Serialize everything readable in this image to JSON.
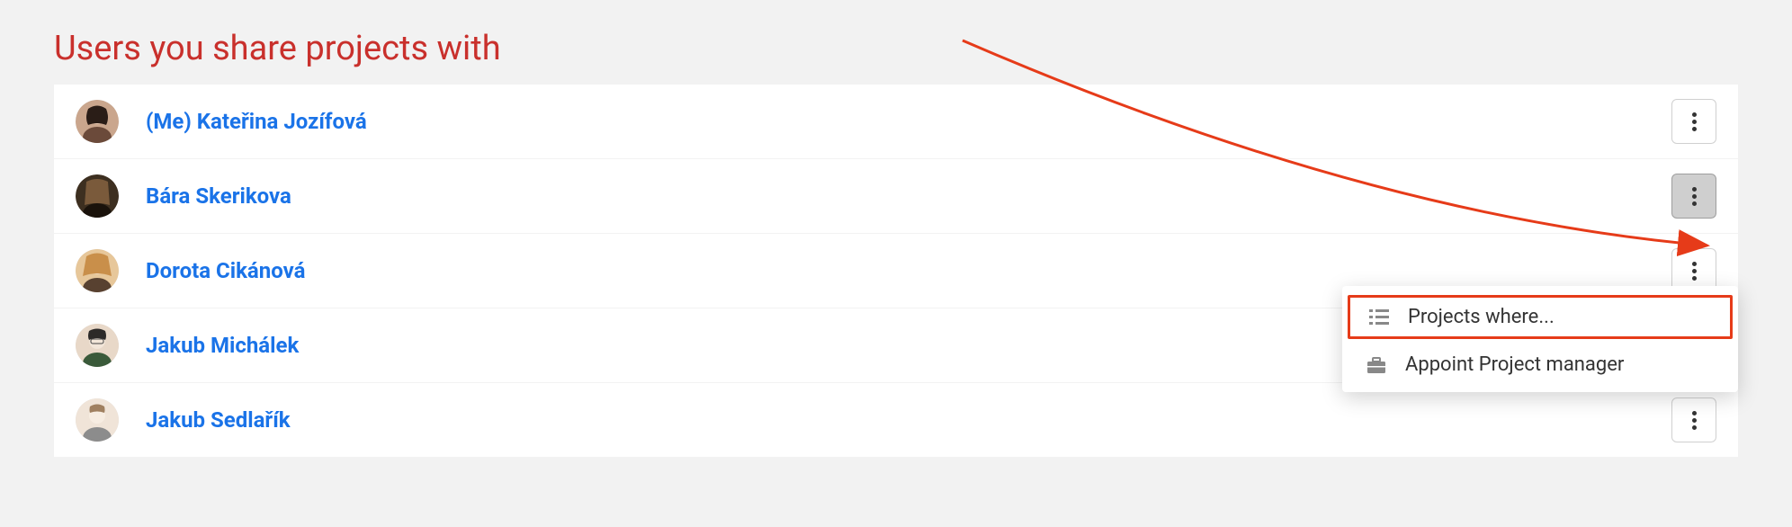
{
  "header": {
    "title": "Users you share projects with"
  },
  "users": [
    {
      "me_prefix": "(Me) ",
      "name": "Kateřina Jozífová",
      "is_me": true,
      "avatar_colors": [
        "#6b4a3a",
        "#caa68d",
        "#2a1d17"
      ]
    },
    {
      "me_prefix": "",
      "name": "Bára Skerikova",
      "is_me": false,
      "avatar_colors": [
        "#7a5a3b",
        "#3d2f20",
        "#1a120b"
      ],
      "menu_open": true
    },
    {
      "me_prefix": "",
      "name": "Dorota Cikánová",
      "is_me": false,
      "avatar_colors": [
        "#c98f4a",
        "#e7c79a",
        "#584130"
      ]
    },
    {
      "me_prefix": "",
      "name": "Jakub Michálek",
      "is_me": false,
      "avatar_colors": [
        "#2c2a28",
        "#e8d8c8",
        "#3a5a3a"
      ]
    },
    {
      "me_prefix": "",
      "name": "Jakub Sedlařík",
      "is_me": false,
      "avatar_colors": [
        "#a08060",
        "#f0e4d8",
        "#8c8c8c"
      ]
    }
  ],
  "dropdown": {
    "items": [
      {
        "label": "Projects where...",
        "icon": "list-icon",
        "highlighted": true
      },
      {
        "label": "Appoint Project manager",
        "icon": "briefcase-icon",
        "highlighted": false
      }
    ]
  },
  "colors": {
    "accent_link": "#1a73e8",
    "title": "#c9302c",
    "highlight_border": "#e63b19"
  }
}
